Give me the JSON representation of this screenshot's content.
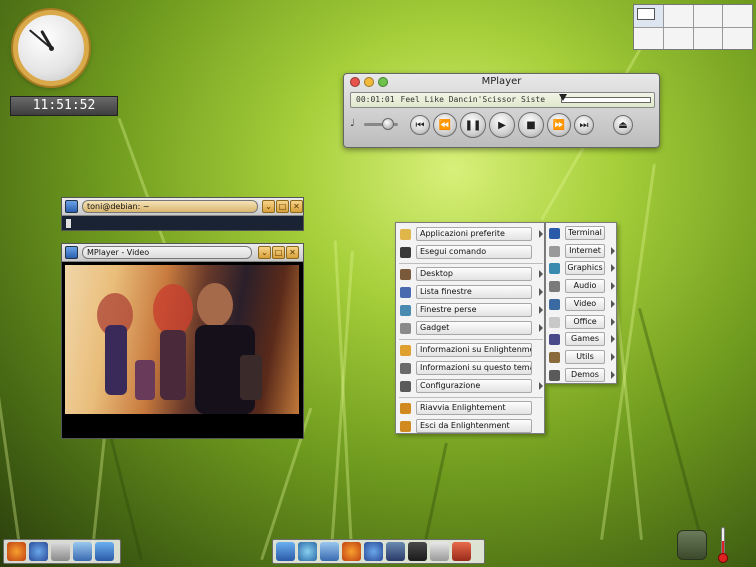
{
  "desktop": {
    "wallpaper": "green grass"
  },
  "clock": {
    "time": "11:51:52"
  },
  "pager": {
    "desktops": 8,
    "active_index": 0
  },
  "mplayer": {
    "title": "MPlayer",
    "elapsed": "00:01:01",
    "track": "Feel Like Dancin'Scissor Siste",
    "controls": [
      "prev-icon",
      "rewind-icon",
      "pause-icon",
      "play-icon",
      "stop-icon",
      "forward-icon",
      "next-icon",
      "eject-icon"
    ]
  },
  "terminal": {
    "title": "toni@debian: ~"
  },
  "video_window": {
    "title": "MPlayer - Video"
  },
  "menu": {
    "items": [
      {
        "label": "Applicazioni preferite",
        "submenu": true
      },
      {
        "label": "Esegui comando",
        "submenu": false
      },
      {
        "label": "Desktop",
        "submenu": true
      },
      {
        "label": "Lista finestre",
        "submenu": true
      },
      {
        "label": "Finestre perse",
        "submenu": true
      },
      {
        "label": "Gadget",
        "submenu": true
      },
      {
        "label": "Informazioni su Enlightenment",
        "submenu": false
      },
      {
        "label": "Informazioni su questo tema",
        "submenu": false
      },
      {
        "label": "Configurazione",
        "submenu": true
      },
      {
        "label": "Riavvia Enlightement",
        "submenu": false
      },
      {
        "label": "Esci da Enlightenment",
        "submenu": false
      }
    ]
  },
  "submenu": {
    "items": [
      {
        "label": "Terminal",
        "submenu": false
      },
      {
        "label": "Internet",
        "submenu": true
      },
      {
        "label": "Graphics",
        "submenu": true
      },
      {
        "label": "Audio",
        "submenu": true
      },
      {
        "label": "Video",
        "submenu": true
      },
      {
        "label": "Office",
        "submenu": true
      },
      {
        "label": "Games",
        "submenu": true
      },
      {
        "label": "Utils",
        "submenu": true
      },
      {
        "label": "Demos",
        "submenu": true
      }
    ]
  },
  "dock_left": [
    "firefox-icon",
    "thunderbird-icon",
    "files-icon",
    "desktop-icon",
    "monitor-icon"
  ],
  "dock_center": [
    "monitor-icon",
    "network-icon",
    "desktop-icon",
    "firefox-icon",
    "thunderbird-icon",
    "pidgin-icon",
    "terminal-icon",
    "settings-icon",
    "presentation-icon"
  ],
  "tray": {
    "temperature_label": "temp"
  }
}
